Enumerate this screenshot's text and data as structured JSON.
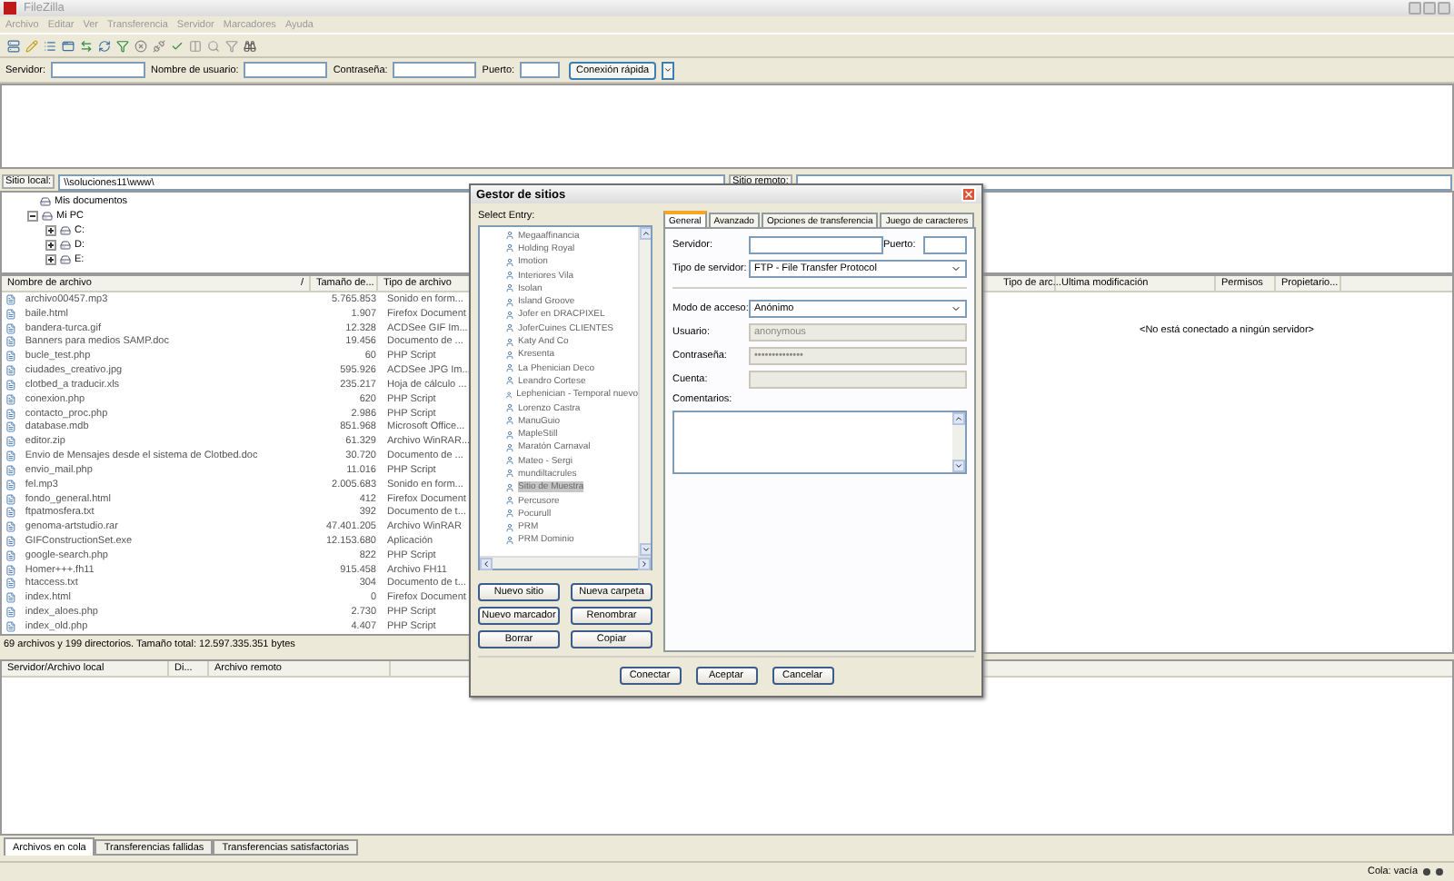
{
  "window": {
    "title": "FileZilla"
  },
  "menu": [
    "Archivo",
    "Editar",
    "Ver",
    "Transferencia",
    "Servidor",
    "Marcadores",
    "Ayuda"
  ],
  "quickconnect": {
    "fields": [
      {
        "label": "Servidor:"
      },
      {
        "label": "Nombre de usuario:"
      },
      {
        "label": "Contraseña:"
      },
      {
        "label": "Puerto:"
      }
    ],
    "button": "Conexión rápida"
  },
  "local": {
    "label": "Sitio local:",
    "path": "\\\\soluciones11\\www\\",
    "tree": [
      {
        "label": "Mis documentos"
      },
      {
        "label": "Mi PC",
        "expanded": true,
        "children": [
          {
            "label": "C:",
            "expanded": false
          },
          {
            "label": "D:",
            "expanded": false
          },
          {
            "label": "E:",
            "expanded": false
          }
        ]
      }
    ],
    "columns": [
      "Nombre de archivo",
      "Tamaño de...",
      "Tipo de archivo"
    ],
    "sort_mark": "/",
    "rows": [
      [
        "archivo00457.mp3",
        "5.765.853",
        "Sonido en form..."
      ],
      [
        "baile.html",
        "1.907",
        "Firefox Document"
      ],
      [
        "bandera-turca.gif",
        "12.328",
        "ACDSee GIF Im..."
      ],
      [
        "Banners para medios SAMP.doc",
        "19.456",
        "Documento de ..."
      ],
      [
        "bucle_test.php",
        "60",
        "PHP Script"
      ],
      [
        "ciudades_creativo.jpg",
        "595.926",
        "ACDSee JPG Im..."
      ],
      [
        "clotbed_a traducir.xls",
        "235.217",
        "Hoja de cálculo ..."
      ],
      [
        "conexion.php",
        "620",
        "PHP Script"
      ],
      [
        "contacto_proc.php",
        "2.986",
        "PHP Script"
      ],
      [
        "database.mdb",
        "851.968",
        "Microsoft Office..."
      ],
      [
        "editor.zip",
        "61.329",
        "Archivo WinRAR..."
      ],
      [
        "Envio de Mensajes desde el sistema de Clotbed.doc",
        "30.720",
        "Documento de ..."
      ],
      [
        "envio_mail.php",
        "11.016",
        "PHP Script"
      ],
      [
        "fel.mp3",
        "2.005.683",
        "Sonido en form..."
      ],
      [
        "fondo_general.html",
        "412",
        "Firefox Document"
      ],
      [
        "ftpatmosfera.txt",
        "392",
        "Documento de t..."
      ],
      [
        "genoma-artstudio.rar",
        "47.401.205",
        "Archivo WinRAR"
      ],
      [
        "GIFConstructionSet.exe",
        "12.153.680",
        "Aplicación"
      ],
      [
        "google-search.php",
        "822",
        "PHP Script"
      ],
      [
        "Homer+++.fh11",
        "915.458",
        "Archivo FH11"
      ],
      [
        "htaccess.txt",
        "304",
        "Documento de t..."
      ],
      [
        "index.html",
        "0",
        "Firefox Document"
      ],
      [
        "index_aloes.php",
        "2.730",
        "PHP Script"
      ],
      [
        "index_old.php",
        "4.407",
        "PHP Script"
      ]
    ],
    "status": "69 archivos y 199 directorios. Tamaño total: 12.597.335.351 bytes"
  },
  "remote": {
    "label": "Sitio remoto:",
    "columns": [
      "Tipo de arc...",
      "Ultima modificación",
      "Permisos",
      "Propietario..."
    ],
    "message": "<No está conectado a ningún servidor>"
  },
  "queue": {
    "columns": [
      "Servidor/Archivo local",
      "Di...",
      "Archivo remoto"
    ],
    "tabs": [
      {
        "label": "Archivos en cola",
        "selected": true
      },
      {
        "label": "Transferencias fallidas",
        "selected": false
      },
      {
        "label": "Transferencias satisfactorias",
        "selected": false
      }
    ]
  },
  "status_bar": {
    "text": "Cola: vacía"
  },
  "dialog": {
    "title": "Gestor de sitios",
    "select_label": "Select Entry:",
    "sites": [
      {
        "label": "Megaaffinancia",
        "selected": false
      },
      {
        "label": "Holding Royal",
        "selected": false
      },
      {
        "label": "Imotion",
        "selected": false
      },
      {
        "label": "Interiores Vila",
        "selected": false
      },
      {
        "label": "Isolan",
        "selected": false
      },
      {
        "label": "Island Groove",
        "selected": false
      },
      {
        "label": "Jofer en DRACPIXEL",
        "selected": false
      },
      {
        "label": "JoferCuines CLIENTES",
        "selected": false
      },
      {
        "label": "Katy And Co",
        "selected": false
      },
      {
        "label": "Kresenta",
        "selected": false
      },
      {
        "label": "La Phenician Deco",
        "selected": false
      },
      {
        "label": "Leandro Cortese",
        "selected": false
      },
      {
        "label": "Lephenician - Temporal nuevo",
        "selected": false
      },
      {
        "label": "Lorenzo Castra",
        "selected": false
      },
      {
        "label": "ManuGuio",
        "selected": false
      },
      {
        "label": "MapleStill",
        "selected": false
      },
      {
        "label": "Maratón Carnaval",
        "selected": false
      },
      {
        "label": "Mateo - Sergi",
        "selected": false
      },
      {
        "label": "mundiltacrules",
        "selected": false
      },
      {
        "label": "Sitio de Muestra",
        "selected": true
      },
      {
        "label": "Percusore",
        "selected": false
      },
      {
        "label": "Pocurull",
        "selected": false
      },
      {
        "label": "PRM",
        "selected": false
      },
      {
        "label": "PRM Dominio",
        "selected": false
      }
    ],
    "left_buttons": [
      "Nuevo sitio",
      "Nueva carpeta",
      "Nuevo marcador",
      "Renombrar",
      "Borrar",
      "Copiar"
    ],
    "tabs": [
      {
        "label": "General",
        "selected": true
      },
      {
        "label": "Avanzado",
        "selected": false
      },
      {
        "label": "Opciones de transferencia",
        "selected": false
      },
      {
        "label": "Juego de caracteres",
        "selected": false
      }
    ],
    "server": {
      "label": "Servidor:",
      "port_label": "Puerto:"
    },
    "fields": [
      {
        "kind": "select",
        "label": "Tipo de servidor:",
        "value": "FTP - File Transfer Protocol",
        "disabled": false
      },
      {
        "kind": "separator"
      },
      {
        "kind": "select",
        "label": "Modo de acceso:",
        "value": "Anónimo",
        "disabled": false
      },
      {
        "kind": "text",
        "label": "Usuario:",
        "value": "anonymous",
        "disabled": true
      },
      {
        "kind": "text",
        "label": "Contraseña:",
        "value": "••••••••••••••",
        "disabled": true
      },
      {
        "kind": "text",
        "label": "Cuenta:",
        "disabled": true
      }
    ],
    "comments_label": "Comentarios:",
    "buttons": [
      "Conectar",
      "Aceptar",
      "Cancelar"
    ]
  }
}
